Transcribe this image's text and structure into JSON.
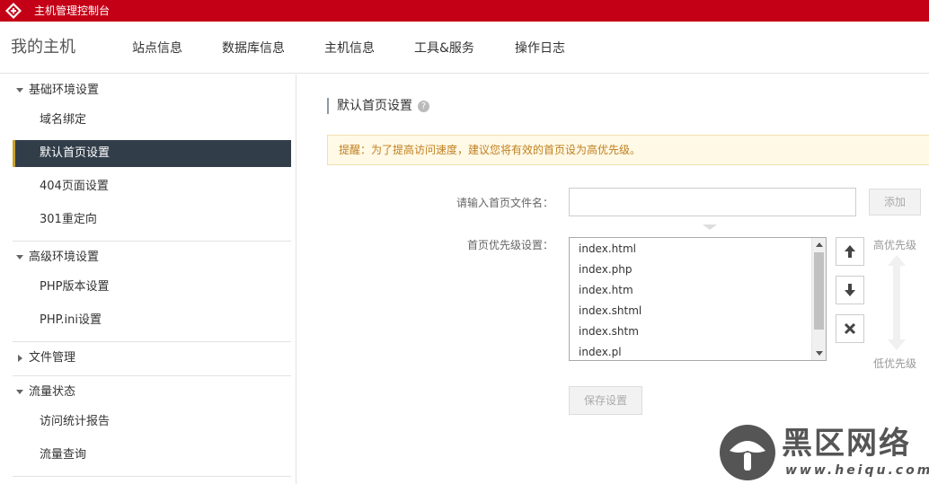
{
  "topbar": {
    "title": "主机管理控制台"
  },
  "nav": {
    "brand": "我的主机",
    "items": [
      "站点信息",
      "数据库信息",
      "主机信息",
      "工具&服务",
      "操作日志"
    ]
  },
  "sidebar": {
    "groups": [
      {
        "label": "基础环境设置",
        "items": [
          "域名绑定",
          "默认首页设置",
          "404页面设置",
          "301重定向"
        ]
      },
      {
        "label": "高级环境设置",
        "items": [
          "PHP版本设置",
          "PHP.ini设置"
        ]
      },
      {
        "label": "文件管理",
        "items": []
      },
      {
        "label": "流量状态",
        "items": [
          "访问统计报告",
          "流量查询"
        ]
      }
    ],
    "active_item": "默认首页设置"
  },
  "main": {
    "section_title": "默认首页设置",
    "help_icon": "?",
    "notice": "提醒：为了提高访问速度，建议您将有效的首页设为高优先级。",
    "input_label": "请输入首页文件名：",
    "input_value": "",
    "add_button": "添加",
    "priority_label": "首页优先级设置：",
    "priority_list": [
      "index.html",
      "index.php",
      "index.htm",
      "index.shtml",
      "index.shtm",
      "index.pl"
    ],
    "high_priority": "高优先级",
    "low_priority": "低优先级",
    "save_button": "保存设置"
  },
  "watermark": {
    "text": "黑区网络",
    "url": "www.heiqu.com"
  },
  "colors": {
    "brand_red": "#c40016",
    "active_bg": "#323d4a",
    "active_accent": "#c8a12a",
    "notice_text": "#c08020"
  },
  "icons": [
    "logo-icon",
    "help-icon",
    "caret-down-icon",
    "caret-right-icon",
    "arrow-up-icon",
    "arrow-down-icon",
    "close-icon",
    "mushroom-logo-icon"
  ]
}
